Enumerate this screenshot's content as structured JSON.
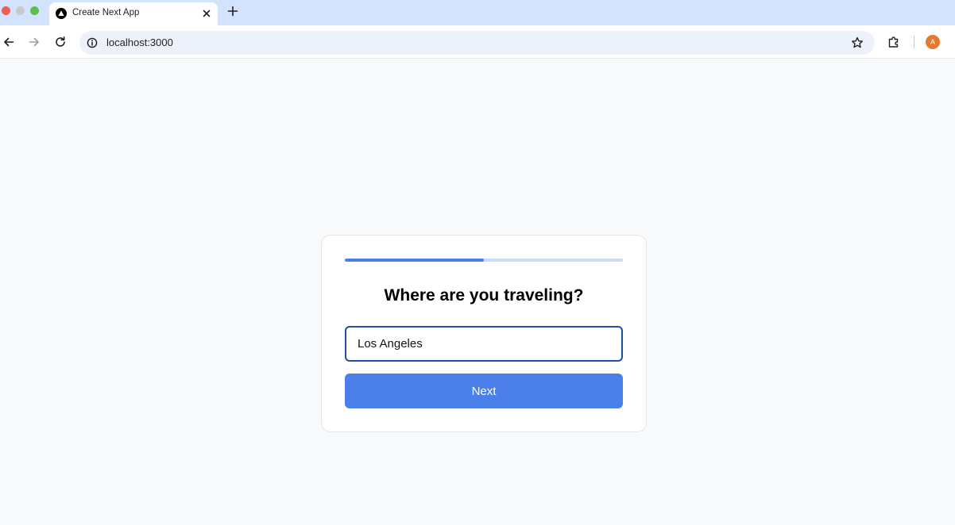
{
  "browser": {
    "tab": {
      "title": "Create Next App",
      "favicon": "nextjs-triangle-icon"
    },
    "url": "localhost:3000",
    "profile_initial": "A",
    "colors": {
      "tabstrip": "#d3e3fd",
      "omnibox": "#edf2fa",
      "avatar": "#e37a2e"
    }
  },
  "form": {
    "progress_fraction": 0.5,
    "question": "Where are you traveling?",
    "answer_value": "Los Angeles",
    "next_label": "Next",
    "colors": {
      "accent": "#4b80ea",
      "progress_track": "#c9dbfb",
      "input_border": "#1d4ea8"
    }
  }
}
